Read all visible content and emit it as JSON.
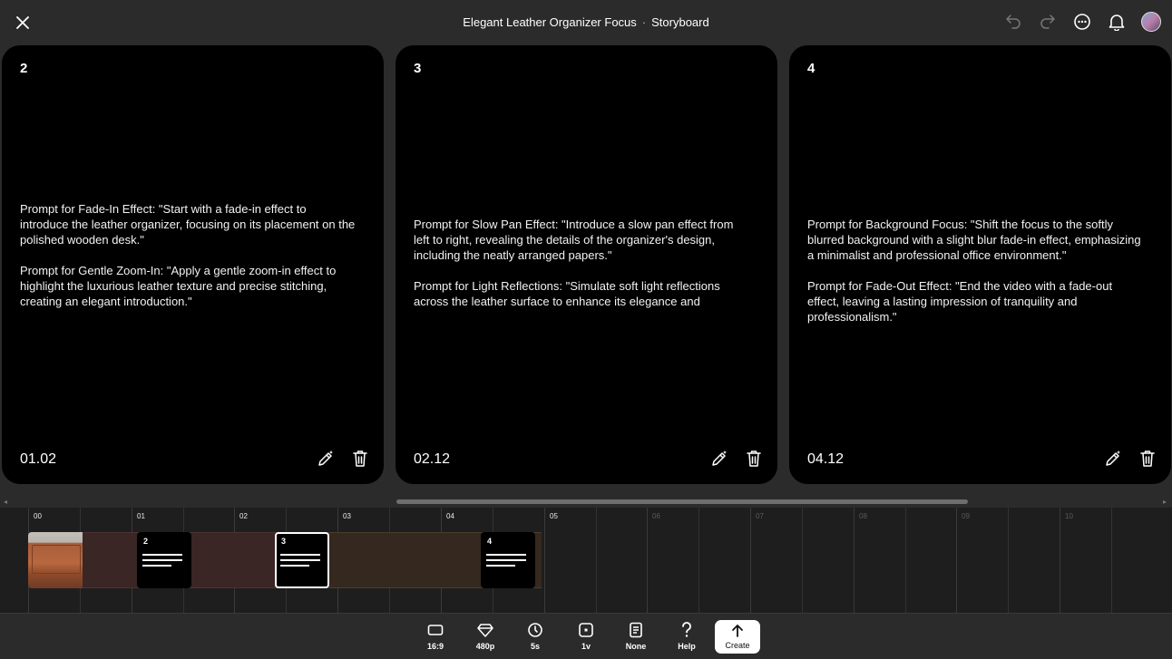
{
  "header": {
    "title": "Elegant Leather Organizer Focus",
    "separator": "·",
    "view": "Storyboard",
    "icons": [
      "close-icon",
      "undo-icon",
      "redo-icon",
      "more-icon",
      "bell-icon",
      "avatar"
    ]
  },
  "cards": [
    {
      "number": "2",
      "paragraphs": [
        "Prompt for Fade-In Effect: \"Start with a fade-in effect to introduce the leather organizer, focusing on its placement on the polished wooden desk.\"",
        "Prompt for Gentle Zoom-In: \"Apply a gentle zoom-in effect to highlight the luxurious leather texture and precise stitching, creating an elegant introduction.\""
      ],
      "time": "01.02"
    },
    {
      "number": "3",
      "paragraphs": [
        "Prompt for Slow Pan Effect: \"Introduce a slow pan effect from left to right, revealing the details of the organizer's design, including the neatly arranged papers.\"",
        "Prompt for Light Reflections: \"Simulate soft light reflections across the leather surface to enhance its elegance and"
      ],
      "time": "02.12"
    },
    {
      "number": "4",
      "paragraphs": [
        "Prompt for Background Focus: \"Shift the focus to the softly blurred background with a slight blur fade-in effect, emphasizing a minimalist and professional office environment.\"",
        "Prompt for Fade-Out Effect: \"End the video with a fade-out effect, leaving a lasting impression of tranquility and professionalism.\""
      ],
      "time": "04.12"
    }
  ],
  "timeline": {
    "ticks": [
      "00",
      "01",
      "02",
      "03",
      "04",
      "05",
      "06",
      "07",
      "08",
      "09",
      "10"
    ],
    "active_ticks": 6,
    "clips": [
      {
        "label": "2",
        "selected": false
      },
      {
        "label": "3",
        "selected": true
      },
      {
        "label": "4",
        "selected": false
      }
    ]
  },
  "toolbar": {
    "aspect": "16:9",
    "resolution": "480p",
    "duration": "5s",
    "variations": "1v",
    "style": "None",
    "help": "Help",
    "create": "Create"
  }
}
